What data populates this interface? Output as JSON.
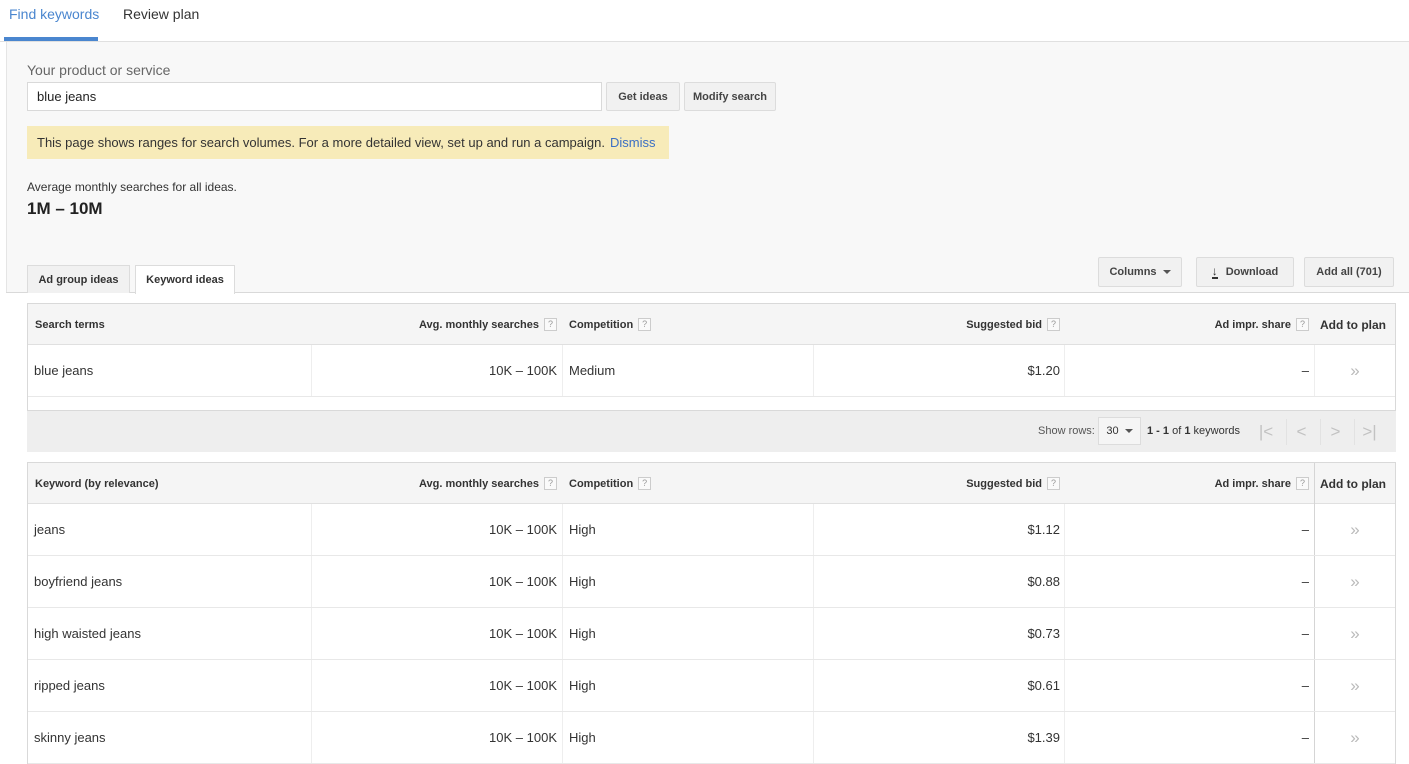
{
  "top_tabs": [
    {
      "label": "Find keywords",
      "active": true
    },
    {
      "label": "Review plan",
      "active": false
    }
  ],
  "search": {
    "label": "Your product or service",
    "value": "blue jeans",
    "get_ideas_label": "Get ideas",
    "modify_search_label": "Modify search"
  },
  "notice": {
    "text": "This page shows ranges for search volumes. For a more detailed view, set up and run a campaign.",
    "dismiss_label": "Dismiss"
  },
  "summary": {
    "label": "Average monthly searches for all ideas.",
    "value": "1M – 10M"
  },
  "sub_tabs": [
    {
      "label": "Ad group ideas",
      "active": false
    },
    {
      "label": "Keyword ideas",
      "active": true
    }
  ],
  "toolbar": {
    "columns_label": "Columns",
    "download_label": "Download",
    "add_all_label": "Add all (701)"
  },
  "help_glyph": "?",
  "add_glyph": "»",
  "search_terms_table": {
    "headers": {
      "keyword": "Search terms",
      "avg": "Avg. monthly searches",
      "competition": "Competition",
      "bid": "Suggested bid",
      "impr": "Ad impr. share",
      "add": "Add to plan"
    },
    "rows": [
      {
        "keyword": "blue jeans",
        "avg": "10K – 100K",
        "competition": "Medium",
        "bid": "$1.20",
        "impr": "–"
      }
    ]
  },
  "pager": {
    "show_rows_label": "Show rows:",
    "rows_value": "30",
    "range_start": "1",
    "range_sep": " - ",
    "range_end": "1",
    "of_label": " of ",
    "total": "1",
    "unit": " keywords",
    "first_glyph": "|<",
    "prev_glyph": "<",
    "next_glyph": ">",
    "last_glyph": ">|"
  },
  "keyword_ideas_table": {
    "headers": {
      "keyword": "Keyword (by relevance)",
      "avg": "Avg. monthly searches",
      "competition": "Competition",
      "bid": "Suggested bid",
      "impr": "Ad impr. share",
      "add": "Add to plan"
    },
    "rows": [
      {
        "keyword": "jeans",
        "avg": "10K – 100K",
        "competition": "High",
        "bid": "$1.12",
        "impr": "–"
      },
      {
        "keyword": "boyfriend jeans",
        "avg": "10K – 100K",
        "competition": "High",
        "bid": "$0.88",
        "impr": "–"
      },
      {
        "keyword": "high waisted jeans",
        "avg": "10K – 100K",
        "competition": "High",
        "bid": "$0.73",
        "impr": "–"
      },
      {
        "keyword": "ripped jeans",
        "avg": "10K – 100K",
        "competition": "High",
        "bid": "$0.61",
        "impr": "–"
      },
      {
        "keyword": "skinny jeans",
        "avg": "10K – 100K",
        "competition": "High",
        "bid": "$1.39",
        "impr": "–"
      }
    ]
  },
  "colors": {
    "accent": "#4a86cf",
    "notice_bg": "#f7ebb9",
    "link": "#3b6fc4"
  }
}
